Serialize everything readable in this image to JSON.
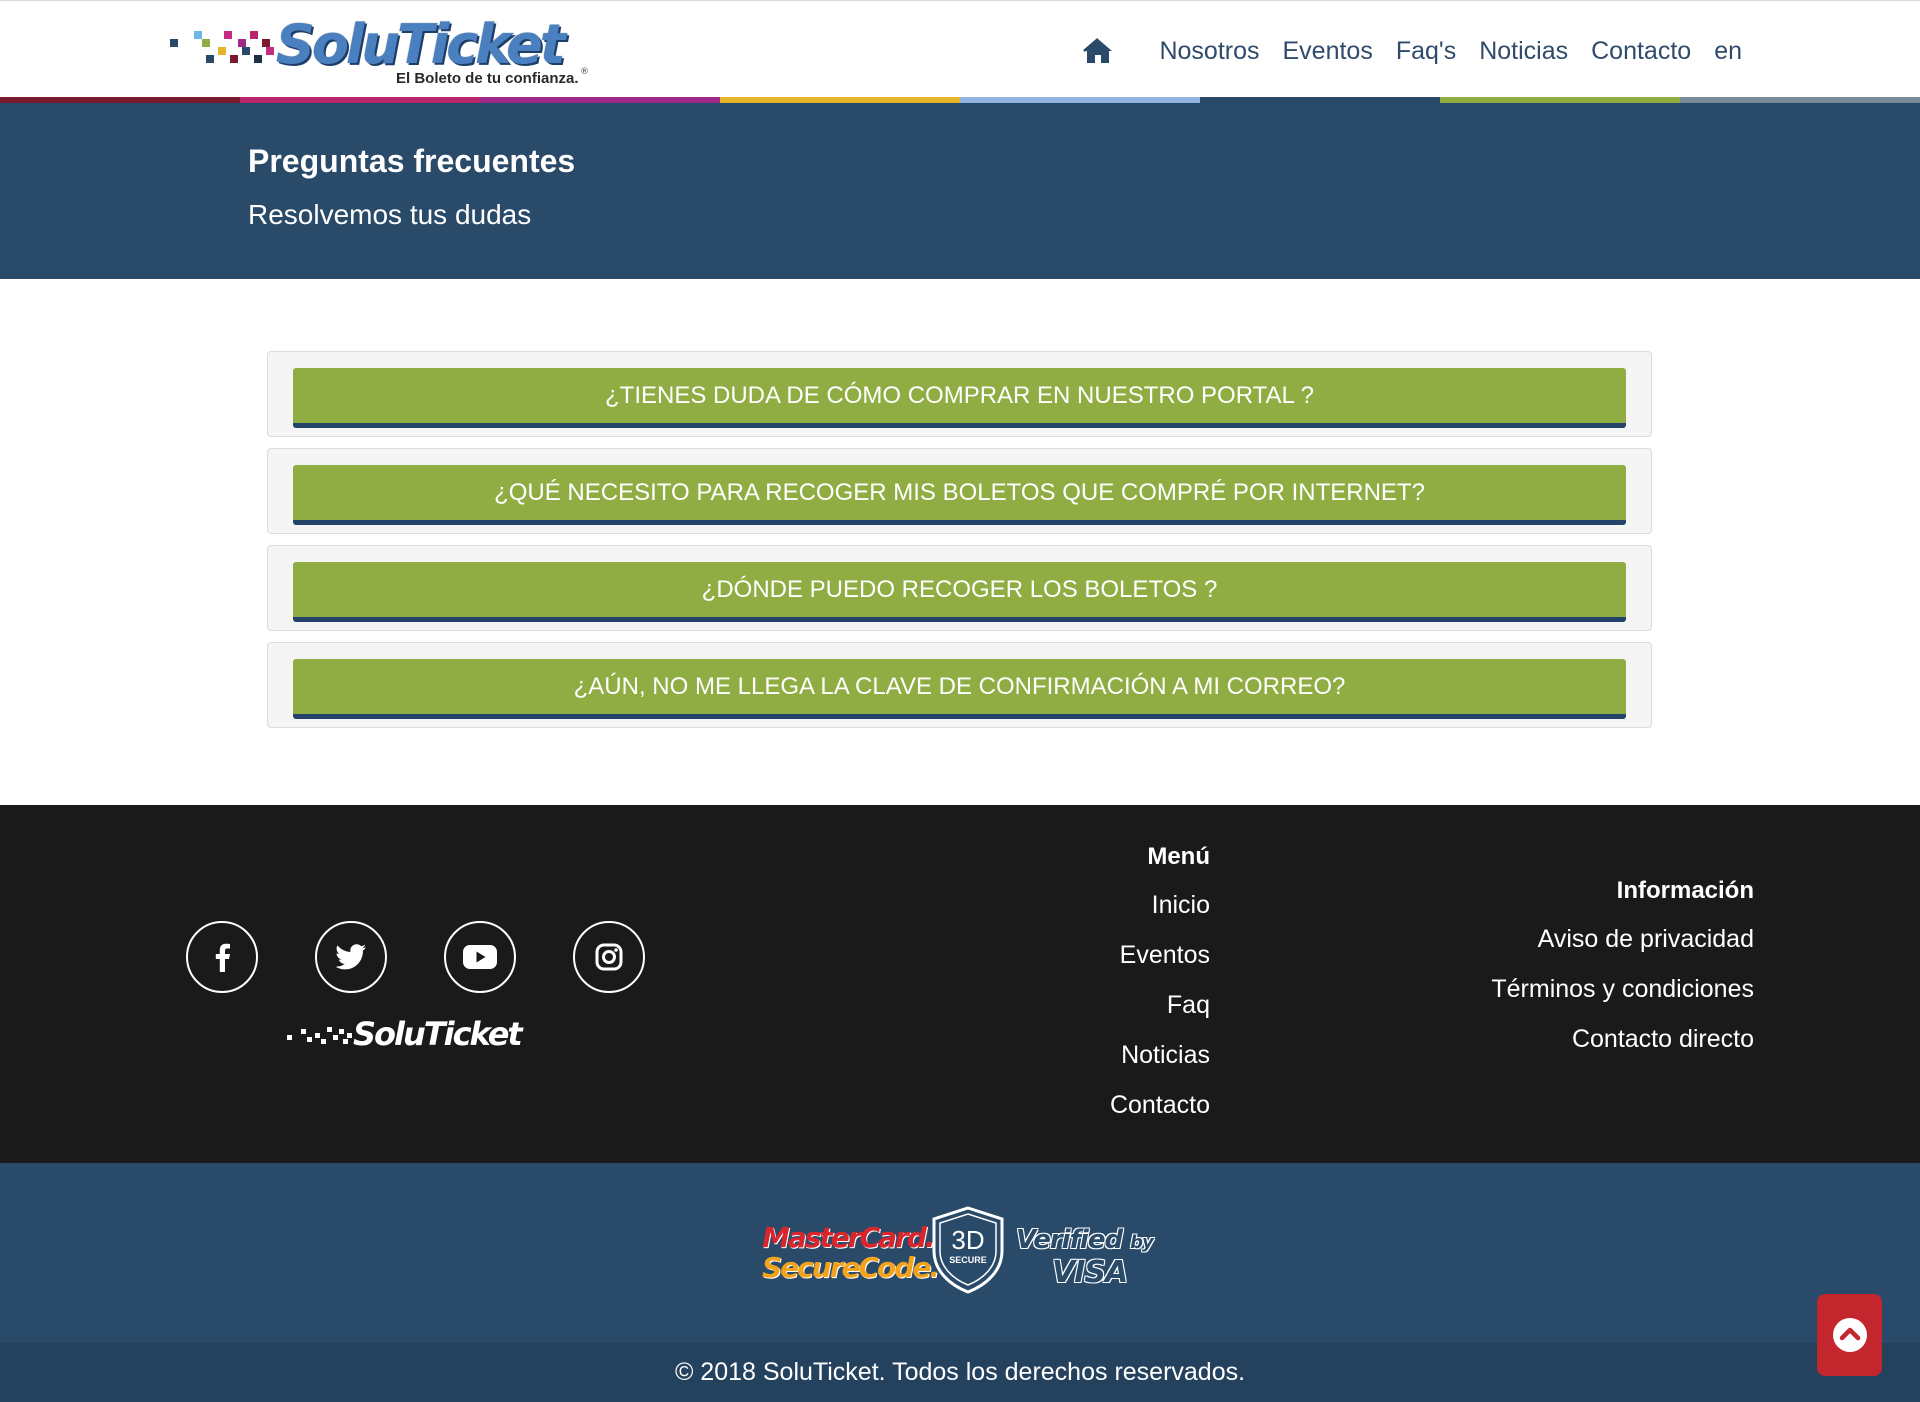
{
  "header": {
    "logo_text": "SoluTicket",
    "logo_tagline": "El Boleto de tu confianza.",
    "logo_reg": "®",
    "nav": [
      "Nosotros",
      "Eventos",
      "Faq's",
      "Noticias",
      "Contacto",
      "en"
    ],
    "stripe_colors": [
      "#7a1a2e",
      "#b8266d",
      "#9d2a8a",
      "#e6b62a",
      "#8fb5e0",
      "#294a68",
      "#8fad42",
      "#7a8a96"
    ]
  },
  "banner": {
    "title": "Preguntas frecuentes",
    "subtitle": "Resolvemos tus dudas"
  },
  "faq": [
    "¿TIENES DUDA DE CÓMO COMPRAR EN NUESTRO PORTAL ?",
    "¿QUÉ NECESITO PARA RECOGER MIS BOLETOS QUE COMPRÉ POR INTERNET?",
    "¿DÓNDE PUEDO RECOGER LOS BOLETOS ?",
    "¿AÚN, NO ME LLEGA LA CLAVE DE CONFIRMACIÓN A MI CORREO?"
  ],
  "footer": {
    "logo_text": "SoluTicket",
    "social": [
      "facebook-icon",
      "twitter-icon",
      "youtube-icon",
      "instagram-icon"
    ],
    "menu": {
      "heading": "Menú",
      "links": [
        "Inicio",
        "Eventos",
        "Faq",
        "Noticias",
        "Contacto"
      ]
    },
    "info": {
      "heading": "Información",
      "links": [
        "Aviso de privacidad",
        "Términos y condiciones",
        "Contacto directo"
      ]
    }
  },
  "payment": {
    "mastercard_l1": "MasterCard.",
    "mastercard_l2": "SecureCode.",
    "secure_big": "3D",
    "secure_small": "SECURE",
    "visa_l1": "Verified",
    "visa_by": "by",
    "visa_l2": "VISA"
  },
  "copyright": "© 2018 SoluTicket. Todos los derechos reservados.",
  "colors": {
    "brand_navy": "#294a68",
    "faq_green": "#8fad42",
    "footer_dark": "#1a1a1a",
    "scroll_top_red": "#c3262c"
  }
}
